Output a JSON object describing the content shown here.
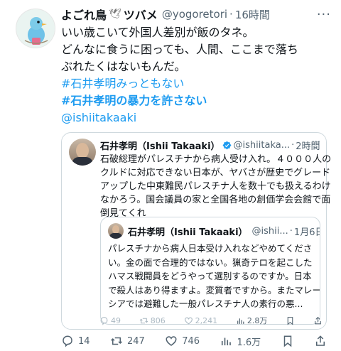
{
  "tweet": {
    "author_name": "よごれ鳥",
    "author_emoji": "🕊",
    "author_name_suffix": "ツバメ",
    "handle": "@yogoretori",
    "separator": "·",
    "time": "16時間",
    "more": "···",
    "lines": [
      "いい歳こいて外国人差別が飯のタネ。",
      "どんなに食うに困っても、人間、ここまで落ち",
      "ぶれたくはないもんだ。"
    ],
    "hashtag1": "#石井孝明みっともない",
    "hashtag2": "#石井孝明の暴力を許さない",
    "mention": "@ishiitakaaki"
  },
  "quote": {
    "name": "石井孝明（Ishii Takaaki）",
    "handle": "@ishiitaka...",
    "separator": "·",
    "time": "2時間",
    "more": "···",
    "lines": [
      "石破総理がパレスチナから病人受け入れ。４０００人の",
      "クルドに対応できない日本が、ヤバさが歴史でグレード",
      "アップした中東難民パレスチナ人を数十でも扱えるわけ",
      "なかろう。国会議員の家と全国各地の創価学会会館で面",
      "倒見てくれ"
    ],
    "actions": {
      "replies": "49",
      "reposts": "806",
      "likes": "2,241",
      "views": "2.8万"
    }
  },
  "nested_quote": {
    "name": "石井孝明（Ishii Takaaki）",
    "handle": "@ishii...",
    "separator": "·",
    "time": "1月6日",
    "lines": [
      "パレスチナから病人日本受け入れなどやめてくださ",
      "い。金の面で合理的ではない。猟奇テロを起こした",
      "ハマス戦闘員をどうやって選別するのですか。日本",
      "で殺人はあり得ますよ。変質者ですから。またマレー",
      "シアでは避難した一般パレスチナ人の素行の悪..."
    ]
  },
  "actions": {
    "replies": "14",
    "reposts": "247",
    "likes": "746",
    "views": "1.6万"
  },
  "colors": {
    "link": "#1d9bf0",
    "muted": "#536471",
    "border": "#cfd9de",
    "text": "#0f1419"
  }
}
